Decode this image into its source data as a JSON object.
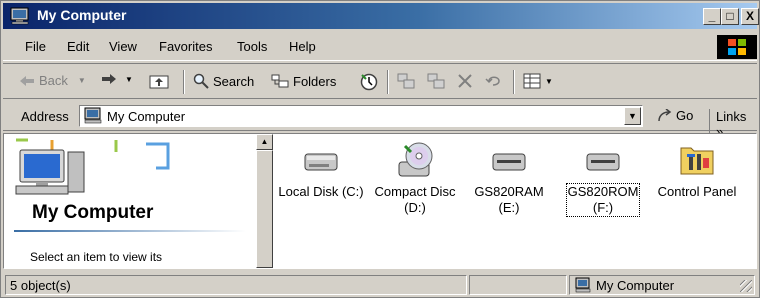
{
  "window": {
    "title": "My Computer",
    "controls": {
      "minimize": "_",
      "maximize": "□",
      "close": "X"
    }
  },
  "menu": [
    "File",
    "Edit",
    "View",
    "Favorites",
    "Tools",
    "Help"
  ],
  "toolbar": {
    "back": "Back",
    "search": "Search",
    "folders": "Folders"
  },
  "address": {
    "label": "Address",
    "value": "My Computer",
    "go": "Go",
    "links": "Links »"
  },
  "left_pane": {
    "title": "My Computer",
    "description": "Select an item to view its"
  },
  "items": [
    {
      "label_line1": "Local Disk (C:)",
      "label_line2": "",
      "icon": "hard-drive-icon"
    },
    {
      "label_line1": "Compact Disc",
      "label_line2": "(D:)",
      "icon": "cd-drive-icon"
    },
    {
      "label_line1": "GS820RAM",
      "label_line2": "(E:)",
      "icon": "removable-drive-icon"
    },
    {
      "label_line1": "GS820ROM",
      "label_line2": "(F:)",
      "icon": "removable-drive-icon"
    },
    {
      "label_line1": "Control Panel",
      "label_line2": "",
      "icon": "control-panel-icon"
    }
  ],
  "status": {
    "count": "5 object(s)",
    "zone": "My Computer"
  },
  "colors": {
    "title_start": "#0a246a",
    "title_end": "#a6caf0",
    "chrome": "#d4d0c8"
  }
}
